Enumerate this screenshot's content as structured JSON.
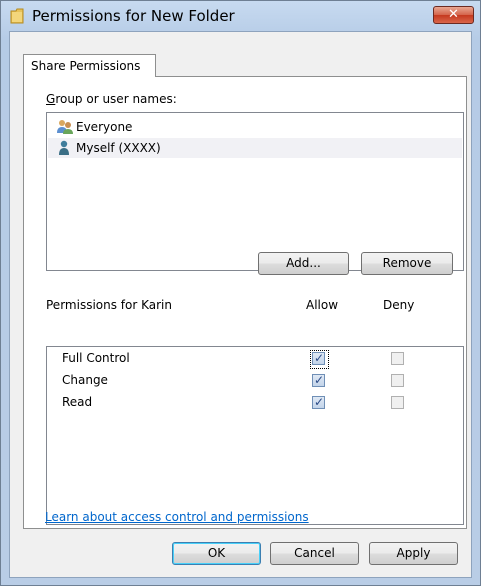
{
  "window": {
    "title": "Permissions for New Folder",
    "close_icon": "close-icon"
  },
  "tab": {
    "label": "Share Permissions"
  },
  "groups": {
    "label": "Group or user names:",
    "label_accel": "G",
    "items": [
      {
        "name": "Everyone",
        "icon": "users-group-icon",
        "selected": false
      },
      {
        "name": "Myself (XXXX)",
        "icon": "user-icon",
        "selected": true
      }
    ],
    "add_label": "Add...",
    "remove_label": "Remove"
  },
  "permissions": {
    "label": "Permissions for Karin",
    "allow_header": "Allow",
    "deny_header": "Deny",
    "rows": [
      {
        "name": "Full Control",
        "allow": true,
        "deny": false
      },
      {
        "name": "Change",
        "allow": true,
        "deny": false
      },
      {
        "name": "Read",
        "allow": true,
        "deny": false
      }
    ]
  },
  "link": {
    "text": "Learn about access control and permissions"
  },
  "footer": {
    "ok_label": "OK",
    "cancel_label": "Cancel",
    "apply_label": "Apply"
  },
  "colors": {
    "link": "#0066cc",
    "frame": "#b9cde6",
    "close": "#c5391f"
  }
}
